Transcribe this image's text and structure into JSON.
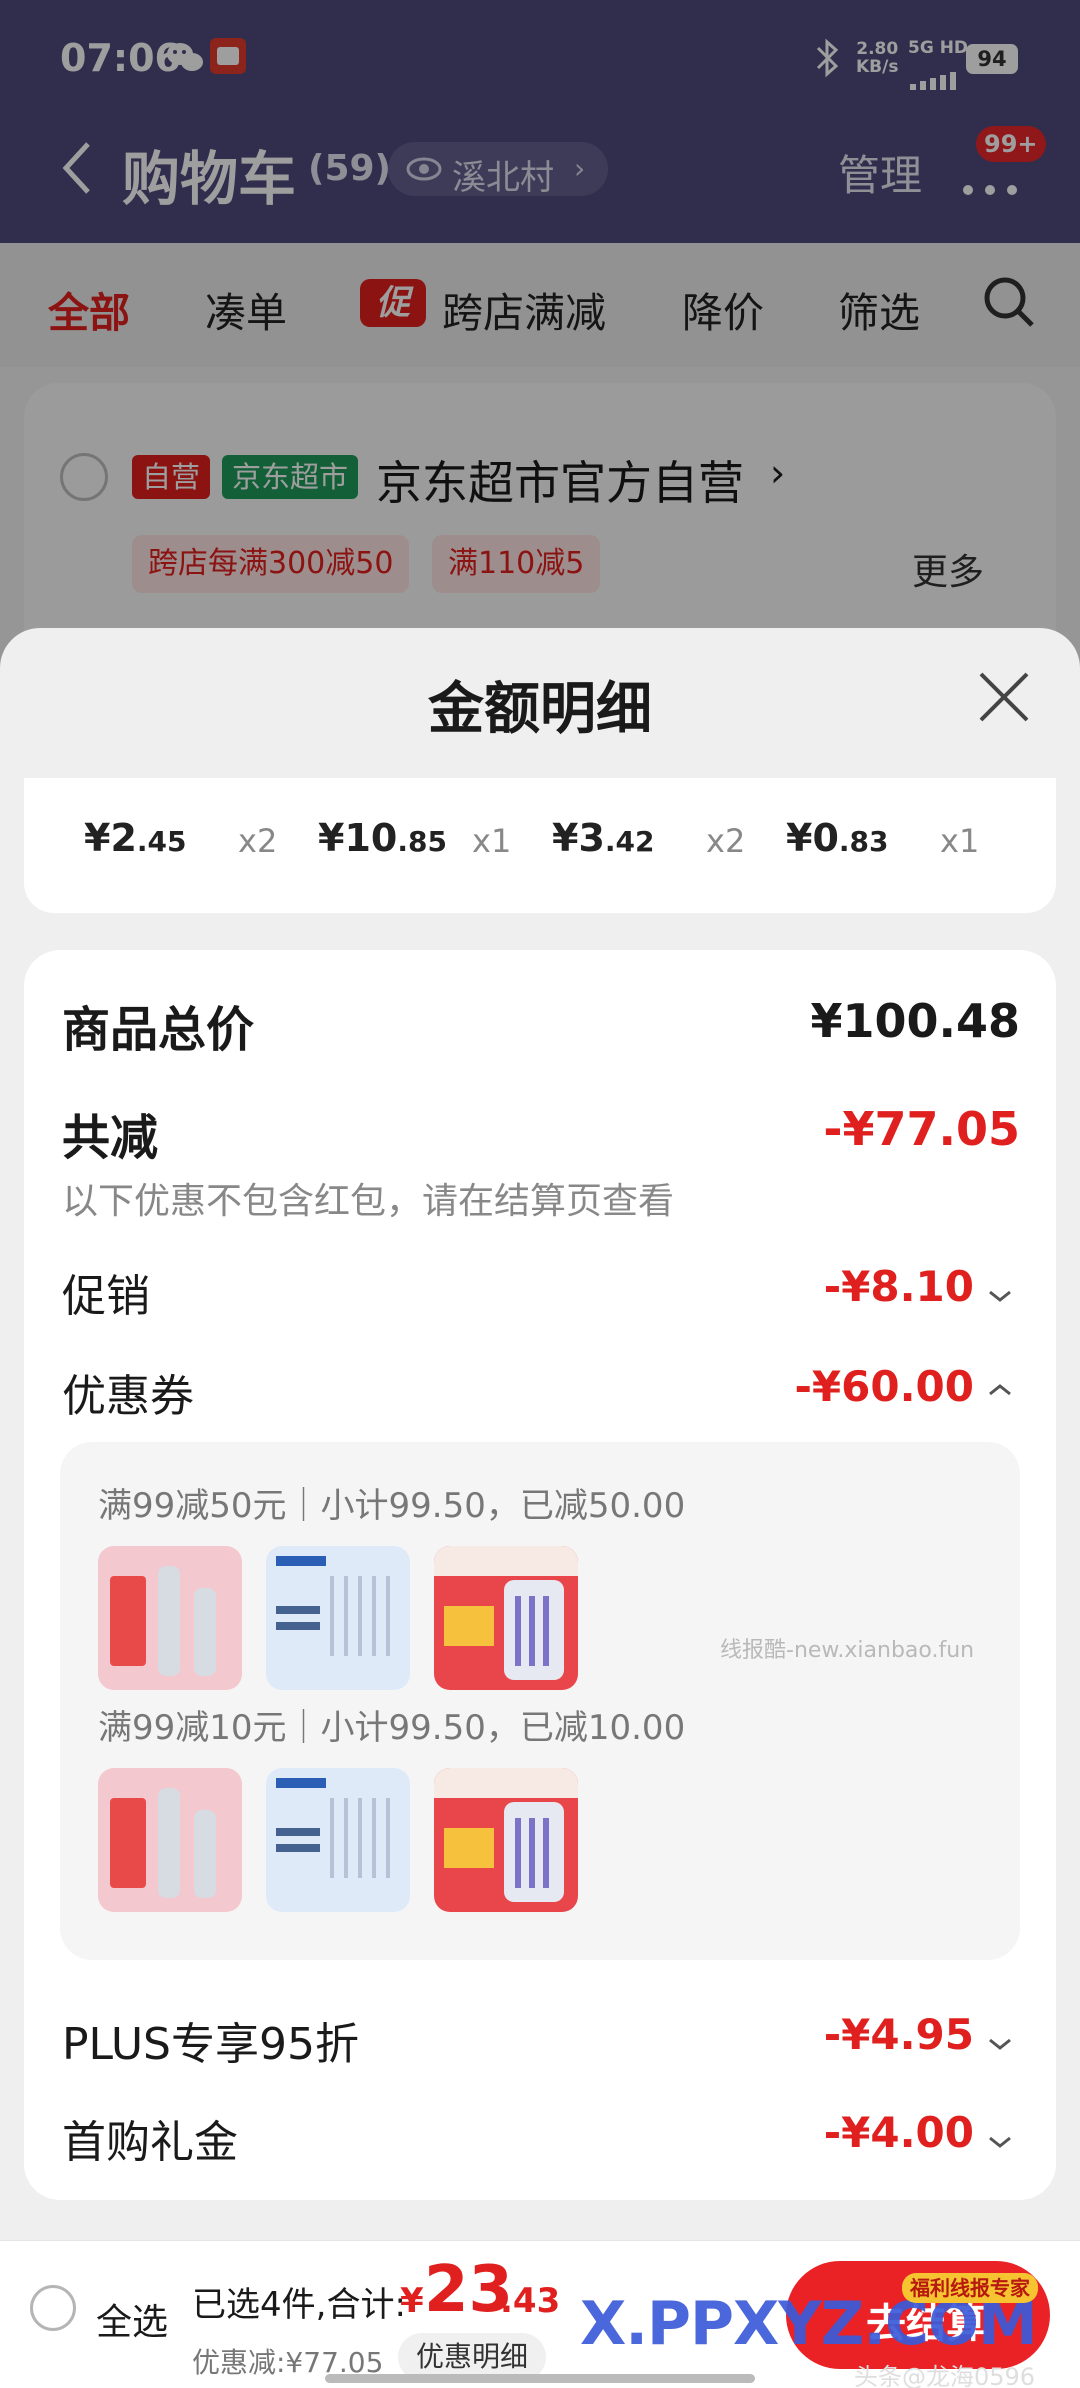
{
  "status_bar": {
    "time": "07:06",
    "net_speed": "2.80",
    "net_unit": "KB/s",
    "network": "5G HD",
    "battery": "94"
  },
  "nav": {
    "back_icon": "chevron-left-icon",
    "title": "购物车",
    "count": "(59)",
    "location": "溪北村",
    "manage": "管理",
    "more_badge": "99+"
  },
  "tabs": [
    {
      "label": "全部",
      "active": true
    },
    {
      "label": "凑单"
    },
    {
      "label": "跨店满减",
      "badge": "促"
    },
    {
      "label": "降价"
    },
    {
      "label": "筛选"
    }
  ],
  "store": {
    "self_tag": "自营",
    "market_tag": "京东超市",
    "name": "京东超市官方自营",
    "promo1": "跨店每满300减50",
    "promo2": "满110减5",
    "more": "更多"
  },
  "sheet": {
    "title": "金额明细",
    "items": [
      {
        "int": "¥2",
        "dec": ".45",
        "qty": "x2"
      },
      {
        "int": "¥10",
        "dec": ".85",
        "qty": "x1"
      },
      {
        "int": "¥3",
        "dec": ".42",
        "qty": "x2"
      },
      {
        "int": "¥0",
        "dec": ".83",
        "qty": "x1"
      }
    ],
    "total_label": "商品总价",
    "total_value": "¥100.48",
    "reduce_label": "共减",
    "reduce_value": "-¥77.05",
    "reduce_note": "以下优惠不包含红包，请在结算页查看",
    "promo_label": "促销",
    "promo_value": "-¥8.10",
    "coupon_label": "优惠券",
    "coupon_value": "-¥60.00",
    "coupons": [
      {
        "title": "满99减50元｜小计99.50，已减50.00"
      },
      {
        "title": "满99减10元｜小计99.50，已减10.00"
      }
    ],
    "watermark": "线报酷-new.xianbao.fun",
    "plus_label": "PLUS专享95折",
    "plus_value": "-¥4.95",
    "first_label": "首购礼金",
    "first_value": "-¥4.00"
  },
  "bottom": {
    "select_all": "全选",
    "selected_prefix": "已选4件,合计:",
    "currency": "¥",
    "total_int": "23",
    "total_dec": ".43",
    "discount": "优惠减:¥77.05",
    "detail_btn": "优惠明细",
    "checkout": "去结算",
    "logo_text": "X.PPXYZ.COM",
    "logo_badge": "福利线报专家",
    "credit": "头条@龙海0596"
  },
  "colors": {
    "topbar": "#4f4b7d",
    "accent_red": "#e0201e",
    "checkout_red": "#ea2226",
    "market_green": "#1f9c5b"
  }
}
